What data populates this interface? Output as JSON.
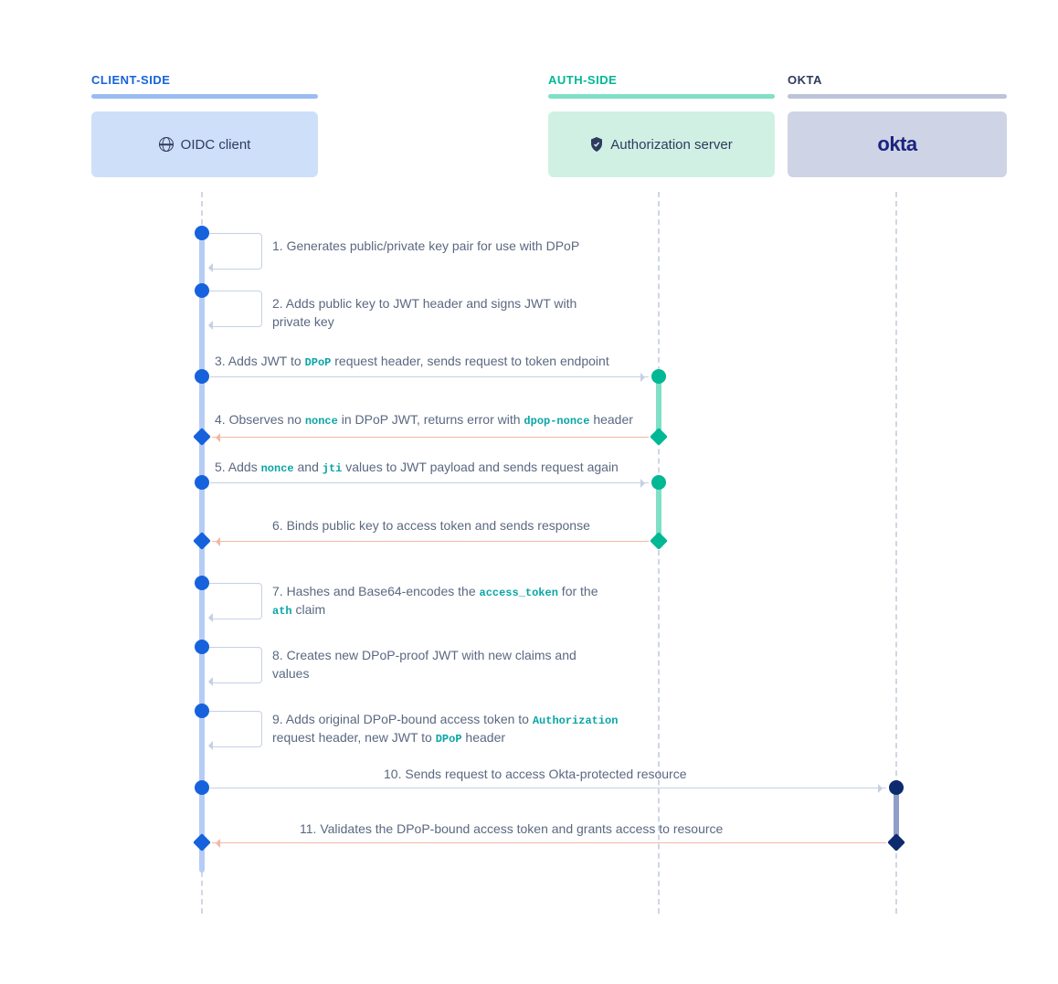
{
  "columns": {
    "client": {
      "label": "CLIENT-SIDE",
      "box": "OIDC client"
    },
    "auth": {
      "label": "AUTH-SIDE",
      "box": "Authorization server"
    },
    "okta": {
      "label": "OKTA",
      "box": "okta"
    }
  },
  "steps": {
    "s1": "1. Generates public/private key pair for use with DPoP",
    "s2": "2. Adds public key to JWT header and signs JWT with private key",
    "s3a": "3. Adds JWT to ",
    "s3code": "DPoP",
    "s3b": " request header, sends request to token endpoint",
    "s4a": "4. Observes no ",
    "s4c1": "nonce",
    "s4b": " in DPoP JWT, returns error with ",
    "s4c2": "dpop-nonce",
    "s4d": " header",
    "s5a": "5. Adds ",
    "s5c1": "nonce",
    "s5b": " and ",
    "s5c2": "jti",
    "s5d": " values to JWT payload and sends request again",
    "s6": "6. Binds public key to access token and sends response",
    "s7a": "7. Hashes and Base64-encodes the ",
    "s7c1": "access_token",
    "s7b": " for the ",
    "s7c2": "ath",
    "s7d": " claim",
    "s8": "8. Creates new DPoP-proof JWT with new claims and values",
    "s9a": "9. Adds original DPoP-bound access token to ",
    "s9c1": "Authorization",
    "s9b": " request header, new JWT to ",
    "s9c2": "DPoP",
    "s9d": " header",
    "s10": "10. Sends request to access Okta-protected resource",
    "s11": "11. Validates the DPoP-bound access token and grants access to resource"
  }
}
